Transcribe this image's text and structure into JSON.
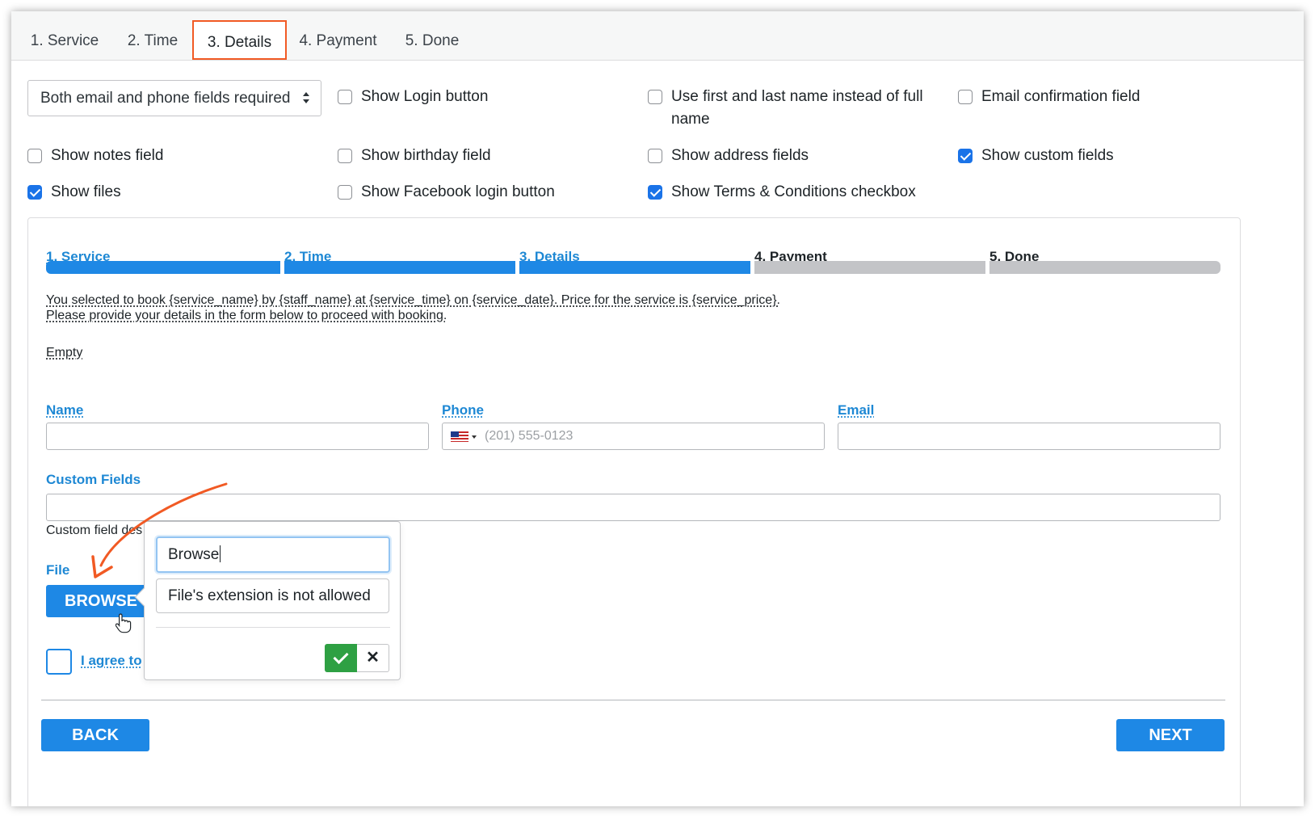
{
  "tabs": [
    {
      "label": "1. Service"
    },
    {
      "label": "2. Time"
    },
    {
      "label": "3. Details"
    },
    {
      "label": "4. Payment"
    },
    {
      "label": "5. Done"
    }
  ],
  "active_tab": "3. Details",
  "settings": {
    "required_select": "Both email and phone fields required",
    "options": [
      {
        "label": "Show Login button",
        "checked": false
      },
      {
        "label": "Use first and last name instead of full name",
        "checked": false
      },
      {
        "label": "Email confirmation field",
        "checked": false
      },
      {
        "label": "Show notes field",
        "checked": false
      },
      {
        "label": "Show birthday field",
        "checked": false
      },
      {
        "label": "Show address fields",
        "checked": false
      },
      {
        "label": "Show custom fields",
        "checked": true
      },
      {
        "label": "Show files",
        "checked": true
      },
      {
        "label": "Show Facebook login button",
        "checked": false
      },
      {
        "label": "Show Terms & Conditions checkbox",
        "checked": true
      }
    ]
  },
  "progress": {
    "steps": [
      {
        "label": "1. Service",
        "done": true
      },
      {
        "label": "2. Time",
        "done": true
      },
      {
        "label": "3. Details",
        "done": true
      },
      {
        "label": "4. Payment",
        "done": false
      },
      {
        "label": "5. Done",
        "done": false
      }
    ]
  },
  "form": {
    "info_line1": "You selected to book {service_name} by {staff_name} at {service_time} on {service_date}. Price for the service is {service_price}.",
    "info_line2": "Please provide your details in the form below to proceed with booking.",
    "empty_text": "Empty",
    "name_label": "Name",
    "phone_label": "Phone",
    "phone_placeholder": "(201) 555-0123",
    "email_label": "Email",
    "custom_fields_label": "Custom Fields",
    "custom_field_desc": "Custom field des",
    "file_label": "File",
    "browse_label": "BROWSE",
    "agree_label": "I agree to",
    "back_label": "BACK",
    "next_label": "NEXT"
  },
  "popover": {
    "input1_value": "Browse",
    "input2_value": "File's extension is not allowed",
    "cancel_symbol": "✕"
  },
  "colors": {
    "accent": "#1e88e5",
    "highlight": "#f15a24",
    "confirm": "#2ea043",
    "pending": "#c3c4c7"
  }
}
